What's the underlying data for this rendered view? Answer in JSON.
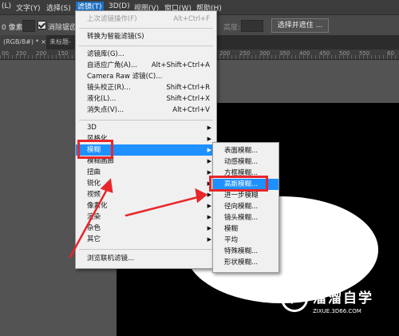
{
  "menubar": {
    "items": [
      "(L)",
      "文字(Y)",
      "选择(S)",
      "滤镜(T)",
      "3D(D)",
      "视图(V)",
      "窗口(W)",
      "帮助(H)"
    ]
  },
  "options": {
    "pixels_label": "0 像素",
    "antialias_label": "消除锯齿",
    "height_label": "高度:",
    "select_subject": "选择并遮住 ..."
  },
  "tabs": {
    "tab1": "(RGB/8#) *  ×",
    "tab2": "未标题-"
  },
  "ruler": {
    "ticks": [
      "00",
      "250",
      "200",
      "150",
      "100",
      "50",
      "0",
      "50",
      "100",
      "150",
      "200",
      "250",
      "300",
      "350",
      "400",
      "450",
      "500",
      "550",
      "60"
    ]
  },
  "filter_menu": {
    "last_filter": "上次滤镜操作(F)",
    "last_filter_shortcut": "Alt+Ctrl+F",
    "convert_smart": "转换为智能滤镜(S)",
    "filter_gallery": "滤镜库(G)...",
    "adaptive_wide": "自适应广角(A)...",
    "adaptive_wide_shortcut": "Alt+Shift+Ctrl+A",
    "camera_raw": "Camera Raw 滤镜(C)...",
    "camera_raw_shortcut": "Shift+Ctrl+A",
    "lens_correction": "镜头校正(R)...",
    "lens_correction_shortcut": "Shift+Ctrl+R",
    "liquify": "液化(L)...",
    "liquify_shortcut": "Shift+Ctrl+X",
    "vanishing_point": "消失点(V)...",
    "vanishing_point_shortcut": "Alt+Ctrl+V",
    "submenus": [
      "3D",
      "风格化",
      "模糊",
      "模糊画廊",
      "扭曲",
      "锐化",
      "视频",
      "像素化",
      "渲染",
      "杂色",
      "其它"
    ],
    "browse_online": "浏览联机滤镜..."
  },
  "blur_menu": {
    "items": [
      "表面模糊...",
      "动感模糊...",
      "方框模糊...",
      "高斯模糊...",
      "进一步模糊",
      "径向模糊...",
      "镜头模糊...",
      "模糊",
      "平均",
      "特殊模糊...",
      "形状模糊..."
    ]
  },
  "watermark": {
    "title": "溜溜自学",
    "url": "ZIXUE.3D66.COM"
  },
  "colors": {
    "highlight": "#1e90ff",
    "annotation_red": "#e8262b"
  }
}
